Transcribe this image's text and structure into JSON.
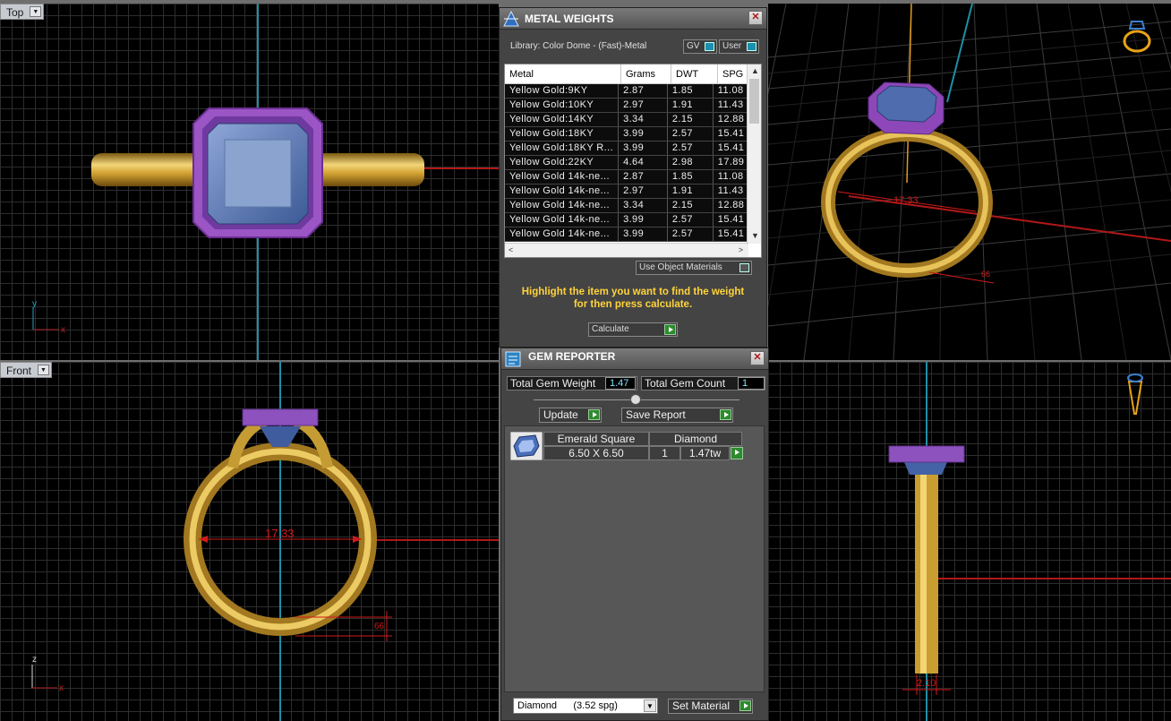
{
  "viewports": {
    "top": {
      "label": "Top"
    },
    "front": {
      "label": "Front",
      "dimension": "17.33",
      "dim_small": "66"
    },
    "perspective": {
      "dimension": "17.33",
      "dim_small": "66"
    },
    "right": {
      "dimension": "2.10"
    }
  },
  "metal_weights": {
    "title": "METAL WEIGHTS",
    "library": "Library: Color Dome - (Fast)-Metal",
    "gv_label": "GV",
    "user_label": "User",
    "columns": [
      "Metal",
      "Grams",
      "DWT",
      "SPG"
    ],
    "rows": [
      {
        "metal": "Yellow Gold:9KY",
        "grams": "2.87",
        "dwt": "1.85",
        "spg": "11.08"
      },
      {
        "metal": "Yellow Gold:10KY",
        "grams": "2.97",
        "dwt": "1.91",
        "spg": "11.43"
      },
      {
        "metal": "Yellow Gold:14KY",
        "grams": "3.34",
        "dwt": "2.15",
        "spg": "12.88"
      },
      {
        "metal": "Yellow Gold:18KY",
        "grams": "3.99",
        "dwt": "2.57",
        "spg": "15.41"
      },
      {
        "metal": "Yellow Gold:18KY R...",
        "grams": "3.99",
        "dwt": "2.57",
        "spg": "15.41"
      },
      {
        "metal": "Yellow Gold:22KY",
        "grams": "4.64",
        "dwt": "2.98",
        "spg": "17.89"
      },
      {
        "metal": "Yellow Gold 14k-ne...",
        "grams": "2.87",
        "dwt": "1.85",
        "spg": "11.08"
      },
      {
        "metal": "Yellow Gold 14k-ne...",
        "grams": "2.97",
        "dwt": "1.91",
        "spg": "11.43"
      },
      {
        "metal": "Yellow Gold 14k-ne...",
        "grams": "3.34",
        "dwt": "2.15",
        "spg": "12.88"
      },
      {
        "metal": "Yellow Gold 14k-ne...",
        "grams": "3.99",
        "dwt": "2.57",
        "spg": "15.41"
      },
      {
        "metal": "Yellow Gold 14k-ne...",
        "grams": "3.99",
        "dwt": "2.57",
        "spg": "15.41"
      }
    ],
    "use_object_materials": "Use Object Materials",
    "hint_line1": "Highlight the item you want to find the weight",
    "hint_line2": "for then press calculate.",
    "calculate_label": "Calculate"
  },
  "gem_reporter": {
    "title": "GEM REPORTER",
    "total_weight_label": "Total Gem Weight",
    "total_weight_value": "1.47",
    "total_count_label": "Total Gem Count",
    "total_count_value": "1",
    "update_label": "Update",
    "save_report_label": "Save Report",
    "gem": {
      "cut": "Emerald Square",
      "material": "Diamond",
      "size": "6.50 X 6.50",
      "count": "1",
      "weight": "1.47tw"
    },
    "material_select": "Diamond      (3.52 spg)",
    "set_material_label": "Set Material"
  }
}
